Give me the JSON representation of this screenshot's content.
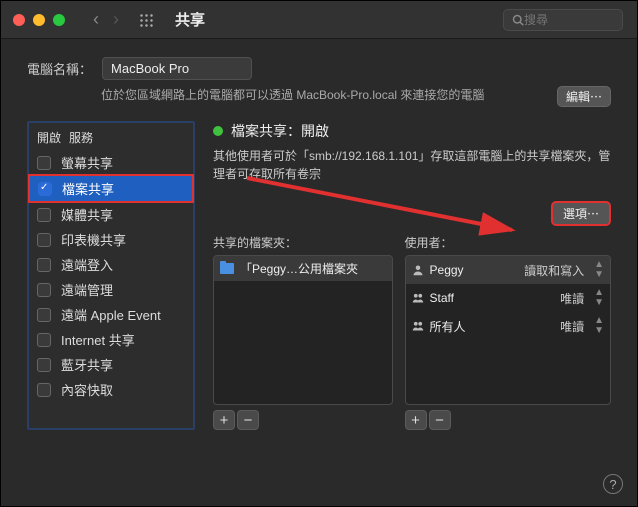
{
  "window": {
    "title": "共享",
    "search_placeholder": "搜尋"
  },
  "computer": {
    "label": "電腦名稱：",
    "value": "MacBook Pro",
    "sub": "位於您區域網路上的電腦都可以透過 MacBook-Pro.local 來連接您的電腦",
    "edit": "編輯⋯"
  },
  "sidebar": {
    "head_on": "開啟",
    "head_svc": "服務",
    "items": [
      {
        "label": "螢幕共享",
        "on": false
      },
      {
        "label": "檔案共享",
        "on": true,
        "selected": true
      },
      {
        "label": "媒體共享",
        "on": false
      },
      {
        "label": "印表機共享",
        "on": false
      },
      {
        "label": "遠端登入",
        "on": false
      },
      {
        "label": "遠端管理",
        "on": false
      },
      {
        "label": "遠端 Apple Event",
        "on": false
      },
      {
        "label": "Internet 共享",
        "on": false
      },
      {
        "label": "藍牙共享",
        "on": false
      },
      {
        "label": "內容快取",
        "on": false
      }
    ]
  },
  "status": {
    "title": "檔案共享：開啟",
    "descr": "其他使用者可於「smb://192.168.1.101」存取這部電腦上的共享檔案夾，管理者可存取所有卷宗",
    "options": "選項⋯"
  },
  "lists": {
    "folders_label": "共享的檔案夾：",
    "users_label": "使用者：",
    "folders": [
      {
        "name": "「Peggy…公用檔案夾"
      }
    ],
    "users": [
      {
        "icon": "person",
        "name": "Peggy",
        "perm": "讀取和寫入"
      },
      {
        "icon": "people",
        "name": "Staff",
        "perm": "唯讀"
      },
      {
        "icon": "people",
        "name": "所有人",
        "perm": "唯讀"
      }
    ]
  }
}
